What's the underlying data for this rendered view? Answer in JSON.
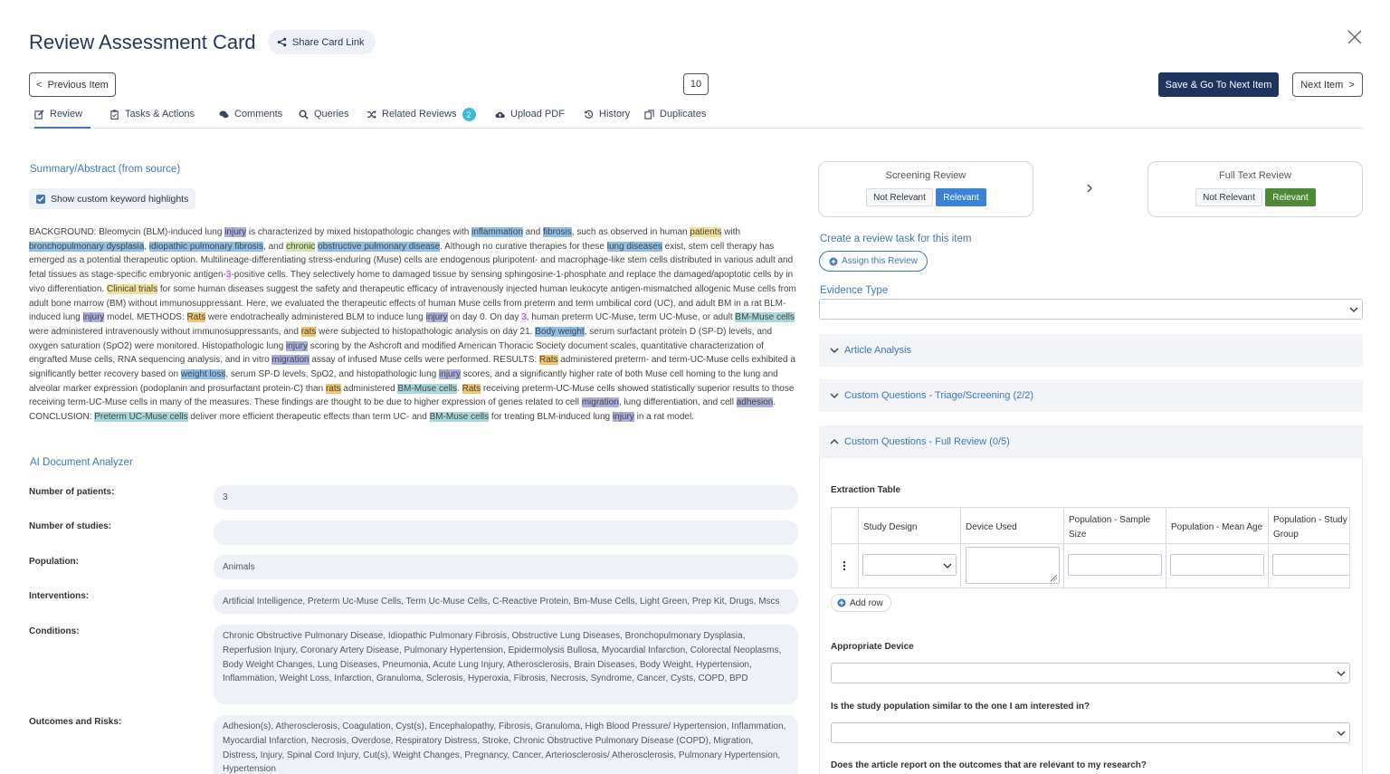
{
  "header": {
    "title": "Review Assessment Card",
    "share_label": "Share Card Link",
    "prev_label": "Previous Item",
    "item_count": "10",
    "save_next_label": "Save & Go To Next Item",
    "next_label": "Next Item"
  },
  "tabs": [
    {
      "label": "Review",
      "icon": "edit-icon"
    },
    {
      "label": "Tasks & Actions",
      "icon": "clipboard-icon"
    },
    {
      "label": "Comments",
      "icon": "comments-icon"
    },
    {
      "label": "Queries",
      "icon": "search-icon"
    },
    {
      "label": "Related Reviews",
      "icon": "shuffle-icon",
      "badge": "2"
    },
    {
      "label": "Upload PDF",
      "icon": "cloud-upload-icon"
    },
    {
      "label": "History",
      "icon": "history-icon"
    },
    {
      "label": "Duplicates",
      "icon": "copy-icon"
    }
  ],
  "left": {
    "summary_heading": "Summary/Abstract (from source)",
    "keyword_toggle_label": "Show custom keyword highlights",
    "keyword_toggle_checked": true,
    "abstract_segments": [
      {
        "t": "BACKGROUND: Bleomycin (BLM)-induced lung "
      },
      {
        "t": "injury",
        "h": "purple"
      },
      {
        "t": " is characterized by mixed histopathologic changes with "
      },
      {
        "t": "inflammation",
        "h": "blue"
      },
      {
        "t": " and "
      },
      {
        "t": "fibrosis",
        "h": "blue"
      },
      {
        "t": ", such as observed in human "
      },
      {
        "t": "patients",
        "h": "yellow"
      },
      {
        "t": " with "
      },
      {
        "t": "bronchopulmonary dysplasia",
        "h": "blue"
      },
      {
        "t": ", "
      },
      {
        "t": "idiopathic pulmonary fibrosis",
        "h": "blue"
      },
      {
        "t": ", and "
      },
      {
        "t": "chronic",
        "h": "green"
      },
      {
        "t": " "
      },
      {
        "t": "obstructive pulmonary disease",
        "h": "blue"
      },
      {
        "t": ". Although no curative therapies for these "
      },
      {
        "t": "lung diseases",
        "h": "blue"
      },
      {
        "t": " exist, stem cell therapy has emerged as a potential therapeutic option. Multilineage-differentiating stress-enduring (Muse) cells are endogenous pluripotent- and macrophage-like stem cells distributed in various adult and fetal tissues as stage-specific embryonic antigen-"
      },
      {
        "t": "3",
        "h": "lilac"
      },
      {
        "t": "-positive cells. They selectively home to damaged tissue by sensing sphingosine-1-phosphate and replace the damaged/apoptotic cells by in vivo differentiation. "
      },
      {
        "t": "Clinical trials",
        "h": "yellow"
      },
      {
        "t": " for some human diseases suggest the safety and therapeutic efficacy of intravenously injected human leukocyte antigen-mismatched allogenic Muse cells from adult bone marrow (BM) without immunosuppressant. Here, we evaluated the therapeutic effects of human Muse cells from preterm and term umbilical cord (UC), and adult BM in a rat BLM-induced lung "
      },
      {
        "t": "injury",
        "h": "purple"
      },
      {
        "t": " model. METHODS: "
      },
      {
        "t": "Rats",
        "h": "orange"
      },
      {
        "t": " were endotracheally administered BLM to induce lung "
      },
      {
        "t": "injury",
        "h": "purple"
      },
      {
        "t": " on day 0. On day "
      },
      {
        "t": "3",
        "h": "lilac"
      },
      {
        "t": ", human preterm UC-Muse, term UC-Muse, or adult "
      },
      {
        "t": "BM-Muse cells",
        "h": "teal"
      },
      {
        "t": " were administered intravenously without immunosuppressants, and "
      },
      {
        "t": "rats",
        "h": "orange"
      },
      {
        "t": " were subjected to histopathologic analysis on day 21. "
      },
      {
        "t": "Body weight",
        "h": "blue"
      },
      {
        "t": ", serum surfactant protein D (SP-D) levels, and oxygen saturation (SpO2) were monitored. Histopathologic lung "
      },
      {
        "t": "injury",
        "h": "purple"
      },
      {
        "t": " scoring by the Ashcroft and modified American Thoracic Society document scales, quantitative characterization of engrafted Muse cells, RNA sequencing analysis, and in vitro "
      },
      {
        "t": "migration",
        "h": "purple"
      },
      {
        "t": " assay of infused Muse cells were performed. RESULTS: "
      },
      {
        "t": "Rats",
        "h": "orange"
      },
      {
        "t": " administered preterm- and term-UC-Muse cells exhibited a significantly better recovery based on "
      },
      {
        "t": "weight loss",
        "h": "blue"
      },
      {
        "t": ", serum SP-D levels, SpO2, and histopathologic lung "
      },
      {
        "t": "injury",
        "h": "purple"
      },
      {
        "t": " scores, and a significantly higher rate of both Muse cell homing to the lung and alveolar marker expression (podoplanin and prosurfactant protein-C) than "
      },
      {
        "t": "rats",
        "h": "orange"
      },
      {
        "t": " administered "
      },
      {
        "t": "BM-Muse cells",
        "h": "teal"
      },
      {
        "t": ". "
      },
      {
        "t": "Rats",
        "h": "orange"
      },
      {
        "t": " receiving preterm-UC-Muse cells showed statistically superior results to those receiving term-UC-Muse cells in many of the measures. These findings are thought to be due to higher expression of genes related to cell "
      },
      {
        "t": "migration",
        "h": "purple"
      },
      {
        "t": ", lung differentiation, and cell "
      },
      {
        "t": "adhesion",
        "h": "purple"
      },
      {
        "t": ". CONCLUSION: "
      },
      {
        "t": "Preterm UC-Muse cells",
        "h": "teal"
      },
      {
        "t": " deliver more efficient therapeutic effects than term UC- and "
      },
      {
        "t": "BM-Muse cells",
        "h": "teal"
      },
      {
        "t": " for treating BLM-induced lung "
      },
      {
        "t": "injury",
        "h": "purple"
      },
      {
        "t": " in a rat model."
      }
    ],
    "ai_heading": "AI Document Analyzer",
    "fields": {
      "patients": {
        "label": "Number of patients:",
        "value": "3"
      },
      "studies": {
        "label": "Number of studies:",
        "value": ""
      },
      "population": {
        "label": "Population:",
        "value": "Animals"
      },
      "interventions": {
        "label": "Interventions:",
        "value": "Artificial Intelligence, Preterm Uc-Muse Cells, Term Uc-Muse Cells, C-Reactive Protein, Bm-Muse Cells, Light Green, Prep Kit, Drugs, Mscs"
      },
      "conditions": {
        "label": "Conditions:",
        "value": "Chronic Obstructive Pulmonary Disease, Idiopathic Pulmonary Fibrosis, Obstructive Lung Diseases, Bronchopulmonary Dysplasia, Reperfusion Injury, Coronary Artery Disease, Pulmonary Hypertension, Epidermolysis Bullosa, Myocardial Infarction, Colorectal Neoplasms, Body Weight Changes, Lung Diseases, Pneumonia, Acute Lung Injury, Atherosclerosis, Brain Diseases, Body Weight, Hypertension, Inflammation, Weight Loss, Infarction, Granuloma, Sclerosis, Hyperoxia, Fibrosis, Necrosis, Syndrome, Cancer, Cysts, COPD, BPD"
      },
      "outcomes": {
        "label": "Outcomes and Risks:",
        "value": "Adhesion(s), Atherosclerosis, Coagulation, Cyst(s), Encephalopathy, Fibrosis, Granuloma, High Blood Pressure/ Hypertension, Inflammation, Myocardial Infarction, Necrosis, Overdose, Respiratory Distress, Stroke, Chronic Obstructive Pulmonary Disease (COPD), Migration, Distress, Injury, Spinal Cord Injury, Cut(s), Weight Changes, Pregnancy, Cancer, Arteriosclerosis/ Atherosclerosis, Pulmonary Hypertension, Hypertension"
      }
    }
  },
  "right": {
    "screening": {
      "title": "Screening Review",
      "not_relevant": "Not Relevant",
      "relevant": "Relevant",
      "selected": "relevant"
    },
    "full_text": {
      "title": "Full Text Review",
      "not_relevant": "Not Relevant",
      "relevant": "Relevant",
      "selected": "relevant"
    },
    "create_task_link": "Create a review task for this item",
    "assign_label": "Assign this Review",
    "evidence_type_label": "Evidence Type",
    "evidence_type_value": "",
    "accordions": {
      "article": "Article Analysis",
      "triage": "Custom Questions - Triage/Screening (2/2)",
      "full_review": "Custom Questions - Full Review (0/5)"
    },
    "extraction": {
      "title": "Extraction Table",
      "columns": [
        "Study Design",
        "Device Used",
        "Population - Sample Size",
        "Population - Mean Age",
        "Population - Study Group"
      ],
      "add_row_label": "Add row"
    },
    "questions": {
      "q1": "Appropriate Device",
      "q2": "Is the study population similar to the one I am interested in?",
      "q3": "Does the article report on the outcomes that are relevant to my research?"
    }
  },
  "colors": {
    "accent": "#3f77b5",
    "dark_button": "#1e3560",
    "relevant_blue": "#3a83d6",
    "relevant_green": "#4c8a37",
    "badge": "#3bbbd7"
  }
}
